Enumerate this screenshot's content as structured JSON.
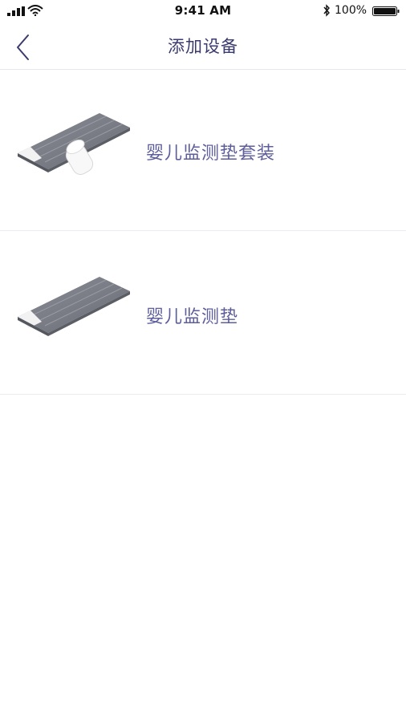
{
  "status_bar": {
    "time": "9:41 AM",
    "battery_percent": "100%",
    "icons": [
      "signal-icon",
      "wifi-icon",
      "bluetooth-icon",
      "battery-icon"
    ]
  },
  "nav": {
    "title": "添加设备",
    "back_icon": "chevron-left-icon"
  },
  "devices": [
    {
      "label": "婴儿监测垫套装",
      "image": "mat-with-sensor"
    },
    {
      "label": "婴儿监测垫",
      "image": "mat"
    }
  ],
  "colors": {
    "accent": "#3a3a6e",
    "label": "#5e5e9c",
    "mat": "#7b7d86",
    "divider": "#e6e6ee"
  }
}
